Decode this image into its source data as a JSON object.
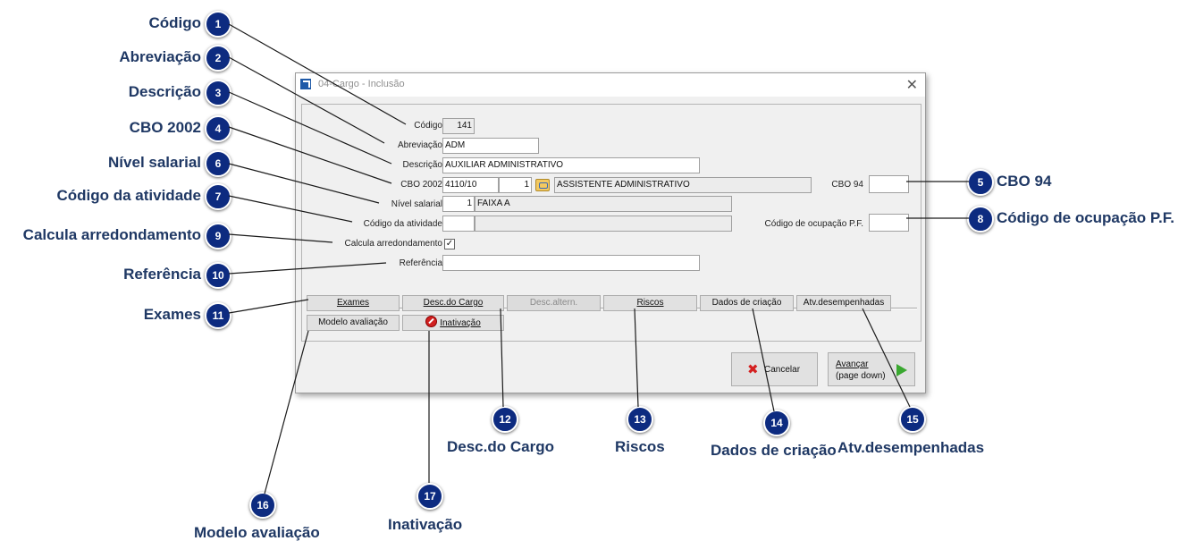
{
  "window": {
    "title": "04-Cargo - Inclusão",
    "close_glyph": "✕"
  },
  "form": {
    "codigo": {
      "label": "Código",
      "value": "141"
    },
    "abreviacao": {
      "label": "Abreviação",
      "value": "ADM"
    },
    "descricao": {
      "label": "Descrição",
      "value": "AUXILIAR ADMINISTRATIVO"
    },
    "cbo2002": {
      "label": "CBO 2002",
      "value": "4110/10",
      "seq": "1",
      "description": "ASSISTENTE ADMINISTRATIVO"
    },
    "cbo94": {
      "label": "CBO 94",
      "value": ""
    },
    "nivel_salarial": {
      "label": "Nível salarial",
      "value": "1",
      "description": "FAIXA A"
    },
    "codigo_atividade": {
      "label": "Código da atividade",
      "value": "",
      "description": ""
    },
    "codigo_ocupacao": {
      "label": "Código de ocupação P.F.",
      "value": ""
    },
    "calcula_arredondamento": {
      "label": "Calcula arredondamento",
      "checked": true,
      "check_glyph": "✓"
    },
    "referencia": {
      "label": "Referência",
      "value": ""
    }
  },
  "buttons": {
    "exames": "Exames",
    "desc_cargo": "Desc.do Cargo",
    "desc_altern": "Desc.altern.",
    "riscos": "Riscos",
    "dados_criacao": "Dados de criação",
    "atv_desempenhadas": "Atv.desempenhadas",
    "modelo_avaliacao": "Modelo avaliação",
    "inativacao": "Inativação",
    "cancelar": "Cancelar",
    "avancar_1": "Avançar",
    "avancar_2": "(page down)"
  },
  "callouts": [
    {
      "n": "1",
      "text": "Código"
    },
    {
      "n": "2",
      "text": "Abreviação"
    },
    {
      "n": "3",
      "text": "Descrição"
    },
    {
      "n": "4",
      "text": "CBO 2002"
    },
    {
      "n": "5",
      "text": "CBO 94"
    },
    {
      "n": "6",
      "text": "Nível salarial"
    },
    {
      "n": "7",
      "text": "Código da atividade"
    },
    {
      "n": "8",
      "text": "Código de ocupação P.F."
    },
    {
      "n": "9",
      "text": "Calcula arredondamento"
    },
    {
      "n": "10",
      "text": "Referência"
    },
    {
      "n": "11",
      "text": "Exames"
    },
    {
      "n": "12",
      "text": "Desc.do Cargo"
    },
    {
      "n": "13",
      "text": "Riscos"
    },
    {
      "n": "14",
      "text": "Dados de criação"
    },
    {
      "n": "15",
      "text": "Atv.desempenhadas"
    },
    {
      "n": "16",
      "text": "Modelo avaliação"
    },
    {
      "n": "17",
      "text": "Inativação"
    }
  ],
  "colors": {
    "badge": "#0d2b80",
    "callout_text": "#1f3864",
    "cancel_icon": "#d42020",
    "next_icon": "#3aa830"
  }
}
